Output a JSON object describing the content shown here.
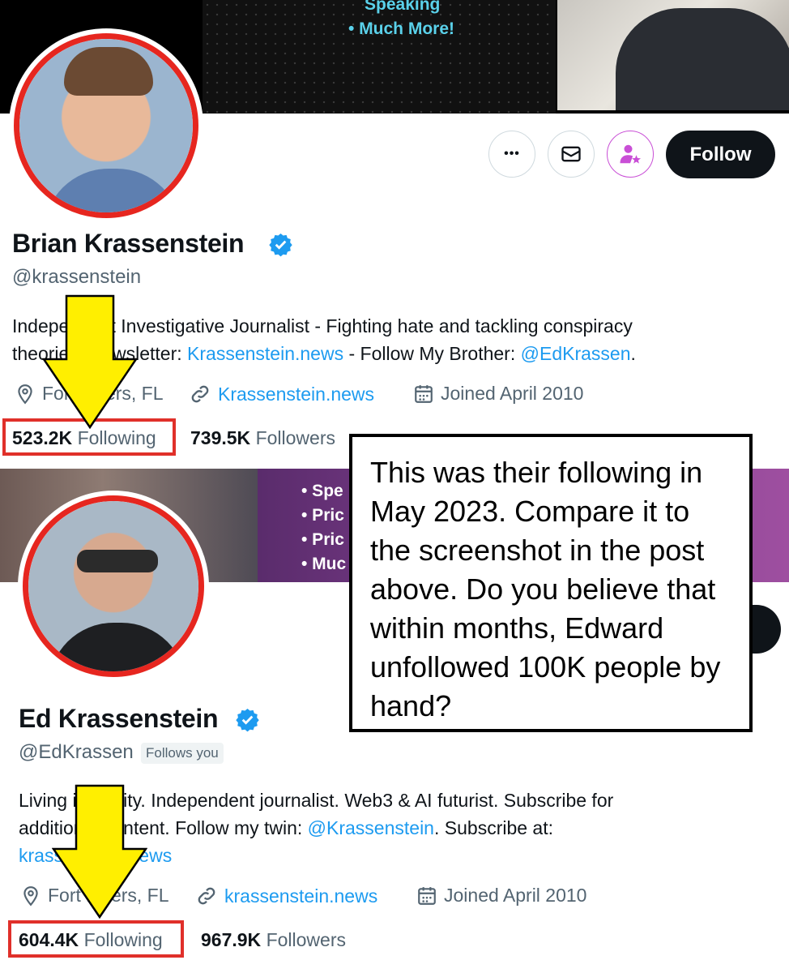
{
  "profile1": {
    "banner_bullets": [
      "Speaking",
      "• Much More!"
    ],
    "buttons": {
      "more_label": "•••",
      "follow_label": "Follow"
    },
    "name": "Brian Krassenstein",
    "handle": "@krassenstein",
    "bio": {
      "line1": "Independent Investigative Journalist - Fighting hate and tackling conspiracy",
      "line2_prefix": "theories. Newsletter: ",
      "line2_link": "Krassenstein.news",
      "line2_mid": " - Follow My Brother: ",
      "line2_mention": "@EdKrassen",
      "line2_suffix": "."
    },
    "location": "Fort Myers, FL",
    "website": "Krassenstein.news",
    "joined": "Joined April 2010",
    "following_count": "523.2K",
    "following_label": "Following",
    "followers_count": "739.5K",
    "followers_label": "Followers"
  },
  "profile2": {
    "banner_bullets": [
      "• Spe",
      "• Pric",
      "• Pric",
      "• Muc"
    ],
    "name": "Ed Krassenstein",
    "handle": "@EdKrassen",
    "follows_you": "Follows you",
    "bio": {
      "line1": "Living in reality. Independent journalist. Web3 & AI futurist. Subscribe for",
      "line2_prefix": "additional content. Follow my twin: ",
      "line2_mention": "@Krassenstein",
      "line2_suffix": ". Subscribe at:",
      "line3_link": "krassenstein.news"
    },
    "location": "Fort Myers, FL",
    "website": "krassenstein.news",
    "joined": "Joined April 2010",
    "following_count": "604.4K",
    "following_label": "Following",
    "followers_count": "967.9K",
    "followers_label": "Followers"
  },
  "callout": {
    "text": "This was their following in May 2023. Compare it to the screenshot in the post above. Do you believe that within months, Edward unfollowed 100K people by hand?"
  },
  "colors": {
    "verified": "#1d9bf0",
    "link": "#1d9bf0",
    "highlight_box": "#e0302a",
    "arrow": "#ffef00",
    "subscribe_purple": "#c94fd6"
  }
}
